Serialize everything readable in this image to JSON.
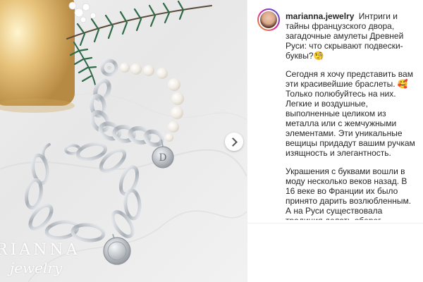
{
  "photo": {
    "alt": "Two silver bracelets with letter pendants on marble",
    "watermark": {
      "line1": "RIANNA",
      "line2": "jewelry"
    },
    "carousel_next_icon": "chevron-right-icon"
  },
  "post": {
    "avatar_icon": "profile-avatar",
    "username": "marianna.jewelry",
    "caption_title": "Интриги и тайны французского двора, загадочные амулеты Древней Руси: что скрывают подвески-буквы?🧐",
    "paragraph_1": "Сегодня я хочу представить вам эти красивейшие браслеты. 🥰\nТолько полюбуйтесь на них.\nЛегкие и воздушные, выполненные целиком из металла или с жемчужными элементами. Эти уникальные вещицы придадут вашим ручкам изящность и элегантность.",
    "paragraph_2": "Украшения с буквами вошли в моду несколько веков назад. В 16 веке во Франции их было принято дарить возлюбленным. А на Руси существовала традиция делать оберег новорожденному с первой"
  },
  "colors": {
    "text": "#262626",
    "divider": "#efefef",
    "candle_gold": "#d7b06a",
    "silver": "#bfc3c8",
    "pearl": "#f4efe6"
  }
}
